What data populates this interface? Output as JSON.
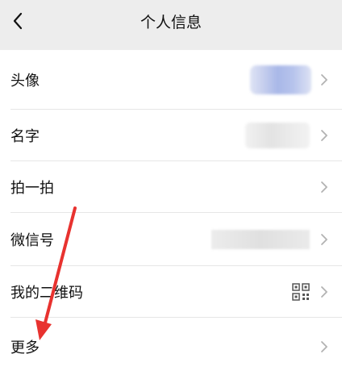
{
  "header": {
    "title": "个人信息",
    "back_icon": "chevron-left-icon"
  },
  "list": {
    "items": [
      {
        "label": "头像",
        "value_type": "avatar-blurred"
      },
      {
        "label": "名字",
        "value_type": "text-blurred"
      },
      {
        "label": "拍一拍",
        "value_type": "none"
      },
      {
        "label": "微信号",
        "value_type": "text-blurred"
      },
      {
        "label": "我的二维码",
        "value_type": "qr-code-icon"
      },
      {
        "label": "更多",
        "value_type": "none"
      }
    ]
  },
  "annotation": {
    "type": "arrow",
    "color": "#e8322f",
    "points_to": "更多"
  },
  "colors": {
    "header_bg": "#ededed",
    "row_bg": "#ffffff",
    "text": "#111111",
    "chevron": "#b2b2b2"
  }
}
